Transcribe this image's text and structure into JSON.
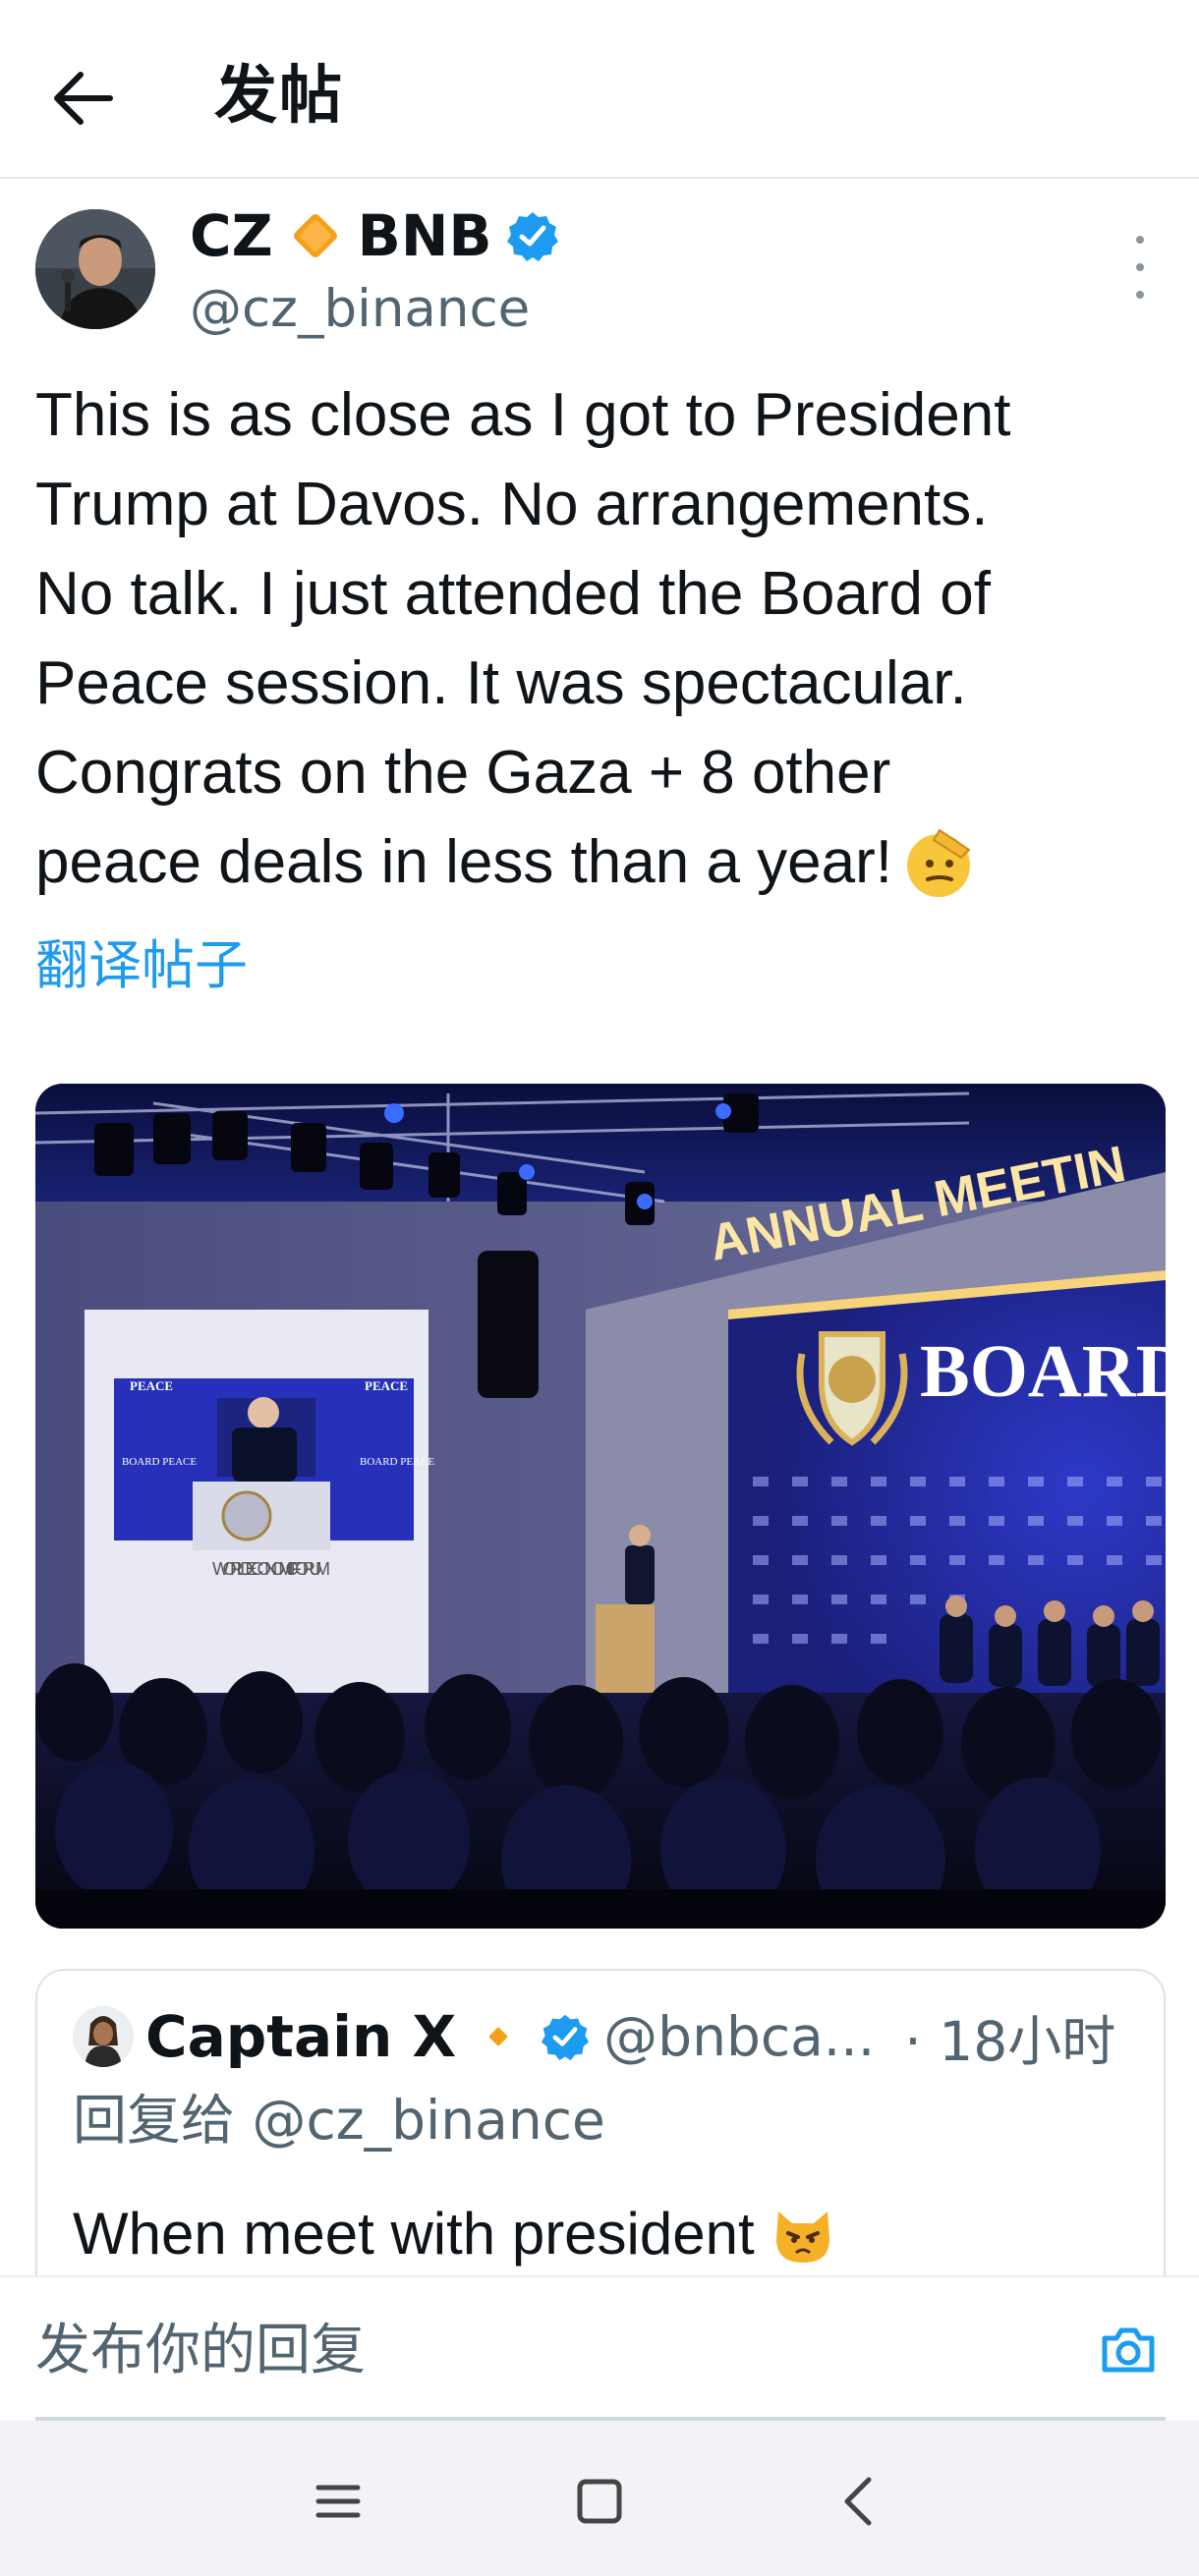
{
  "header": {
    "title": "发帖",
    "back_icon": "arrow-left-icon"
  },
  "post": {
    "author_name_prefix": "CZ",
    "author_name_suffix": "BNB",
    "author_handle": "@cz_binance",
    "badge_color": "#1d9bf0",
    "text_lines": [
      "This is as close as I got to President",
      "Trump at Davos. No arrangements.",
      "No talk. I just attended the Board of",
      "Peace session. It was spectacular.",
      "Congrats on the Gaza + 8 other",
      "peace deals in less than a year!"
    ],
    "translate_label": "翻译帖子",
    "photo": {
      "banner_text": "ANNUAL MEETIN",
      "screen_text": "BOARD",
      "left_screen_top": "PEACE",
      "left_screen_top_right": "PEACE",
      "left_screen_side_left": "BOARD PEACE",
      "left_screen_side_right": "BOARD PEACE",
      "podium_text": "WORLD ECONOMIC FORUM"
    }
  },
  "reply": {
    "name": "Captain X",
    "handle": "@bnbca...",
    "time": "· 18小时",
    "replying_to": "回复给 @cz_binance",
    "text": "When meet with president"
  },
  "compose": {
    "placeholder": "发布你的回复",
    "camera_icon": "camera-icon",
    "accent_color": "#1d9bf0"
  },
  "system_nav": {
    "menu_icon": "menu-icon",
    "home_icon": "home-square-icon",
    "back_icon": "chevron-left-icon"
  }
}
